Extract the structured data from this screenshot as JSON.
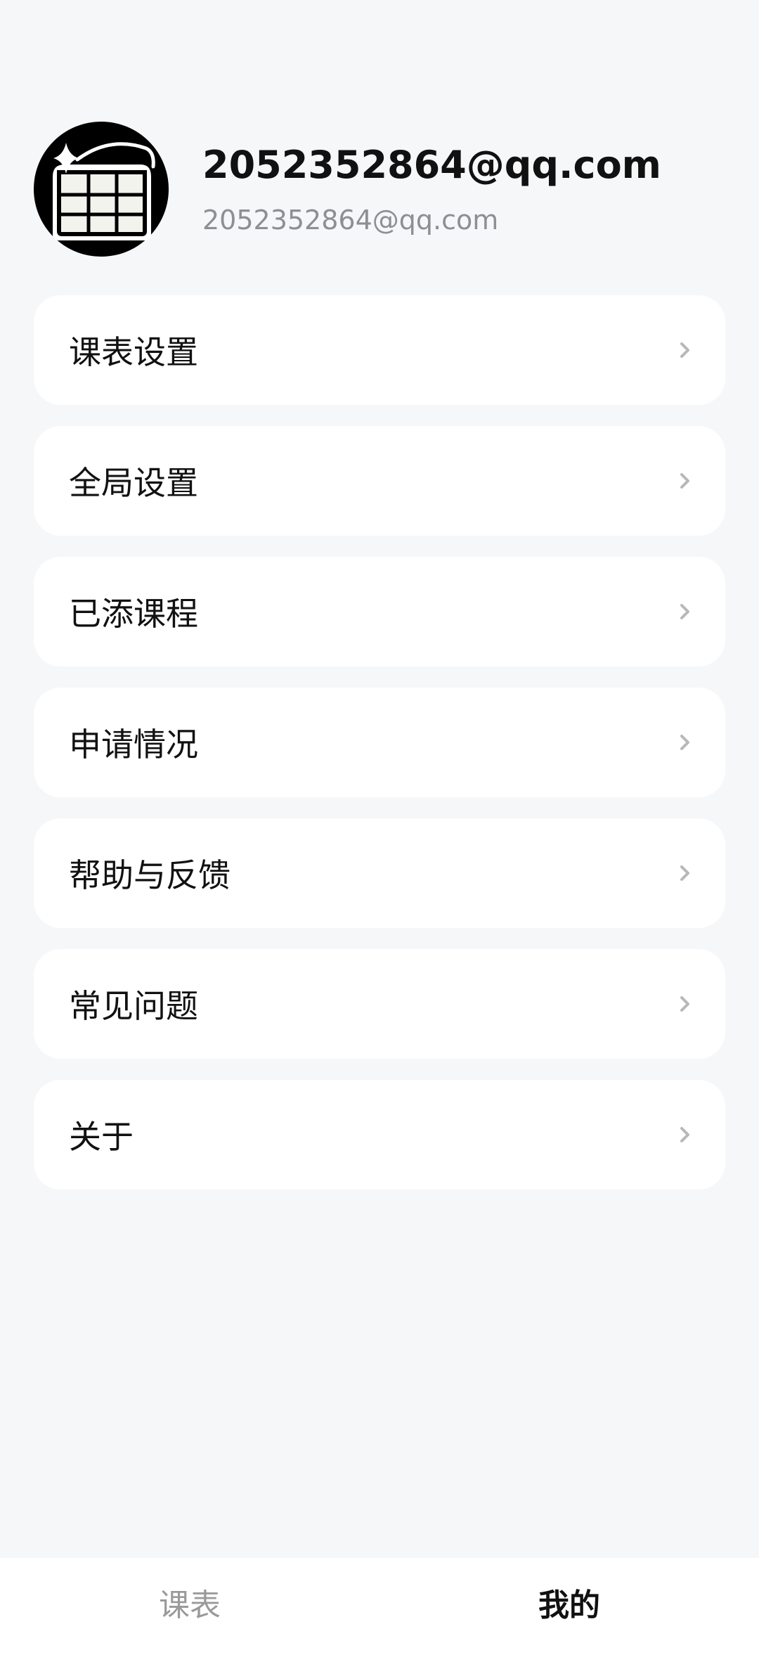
{
  "profile": {
    "name": "2052352864@qq.com",
    "email": "2052352864@qq.com",
    "avatar_icon": "timetable-sparkle-icon"
  },
  "menu": {
    "items": [
      {
        "label": "课表设置",
        "icon": "chevron-right-icon"
      },
      {
        "label": "全局设置",
        "icon": "chevron-right-icon"
      },
      {
        "label": "已添课程",
        "icon": "chevron-right-icon"
      },
      {
        "label": "申请情况",
        "icon": "chevron-right-icon"
      },
      {
        "label": "帮助与反馈",
        "icon": "chevron-right-icon"
      },
      {
        "label": "常见问题",
        "icon": "chevron-right-icon"
      },
      {
        "label": "关于",
        "icon": "chevron-right-icon"
      }
    ]
  },
  "tabbar": {
    "tabs": [
      {
        "label": "课表",
        "active": false
      },
      {
        "label": "我的",
        "active": true
      }
    ]
  },
  "colors": {
    "background": "#f6f7f9",
    "card": "#ffffff",
    "text_primary": "#111111",
    "text_secondary": "#8e8e93",
    "chevron": "#b8b8b8",
    "tab_inactive": "#9a9a9a"
  }
}
